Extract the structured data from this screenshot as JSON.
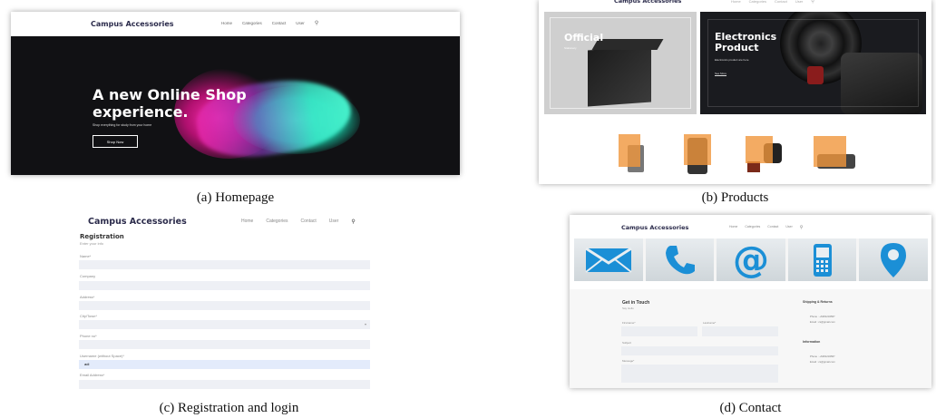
{
  "captions": {
    "a": "(a) Homepage",
    "b": "(b) Products",
    "c": "(c) Registration and login",
    "d": "(d) Contact"
  },
  "nav": {
    "brand": "Campus Accessories",
    "items": [
      "Home",
      "Categories",
      "Contact",
      "User"
    ]
  },
  "homepage": {
    "hero_title_1": "A new Online Shop",
    "hero_title_2": "experience.",
    "hero_subtitle": "Shop everything for study from your home",
    "cta": "Shop Now"
  },
  "products": {
    "card_left_title": "Official",
    "card_left_sub": "Stationery",
    "card_right_title_1": "Electronics",
    "card_right_title_2": "Product",
    "card_right_sub": "Electronics product are here",
    "card_right_link": "See More"
  },
  "registration": {
    "title": "Registration",
    "subtitle": "Enter your info",
    "fields": [
      {
        "label": "Name*",
        "value": ""
      },
      {
        "label": "Company",
        "value": ""
      },
      {
        "label": "Address*",
        "value": ""
      },
      {
        "label": "City/Town*",
        "value": ""
      },
      {
        "label": "Phone no*",
        "value": ""
      },
      {
        "label": "Username (without Space)*",
        "value": "adi"
      },
      {
        "label": "Email Address*",
        "value": ""
      }
    ]
  },
  "contact": {
    "title": "Get in Touch",
    "subtitle": "Say Hello",
    "first_label": "Firstname*",
    "last_label": "Lastname*",
    "subject_label": "Subject",
    "message_label": "Message*",
    "shipping_title": "Shipping & Returns",
    "shipping_phone": "Phone : +6281234567",
    "shipping_email": "Email : cs@gmail.com",
    "info_title": "Information",
    "info_phone": "Phone : +6281234567",
    "info_email": "Email : cs@gmail.com"
  }
}
